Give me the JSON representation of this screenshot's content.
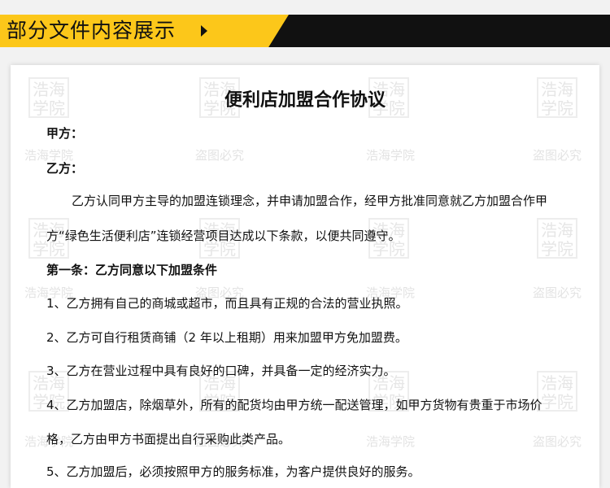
{
  "header": {
    "title": "部分文件内容展示"
  },
  "watermarks": {
    "seal_text": "浩海学院",
    "brand": "浩海学院",
    "warning": "盗图必究"
  },
  "document": {
    "title": "便利店加盟合作协议",
    "party_a": "甲方：",
    "party_b": "乙方：",
    "intro_1": "乙方认同甲方主导的加盟连锁理念，并申请加盟合作，经甲方批准同意就乙方加盟合作甲",
    "intro_2": "方“绿色生活便利店”连锁经营项目达成以下条款，以便共同遵守。",
    "article_1": "第一条：乙方同意以下加盟条件",
    "item_1": "1、乙方拥有自己的商城或超市，而且具有正规的合法的营业执照。",
    "item_2": "2、乙方可自行租赁商铺（2 年以上租期）用来加盟甲方免加盟费。",
    "item_3": "3、乙方在营业过程中具有良好的口碑，并具备一定的经济实力。",
    "item_4a": "4、乙方加盟店，除烟草外，所有的配货均由甲方统一配送管理，如甲方货物有贵重于市场价",
    "item_4b": "格，乙方由甲方书面提出自行采购此类产品。",
    "item_5": "5、乙方加盟后，必须按照甲方的服务标准，为客户提供良好的服务。"
  }
}
